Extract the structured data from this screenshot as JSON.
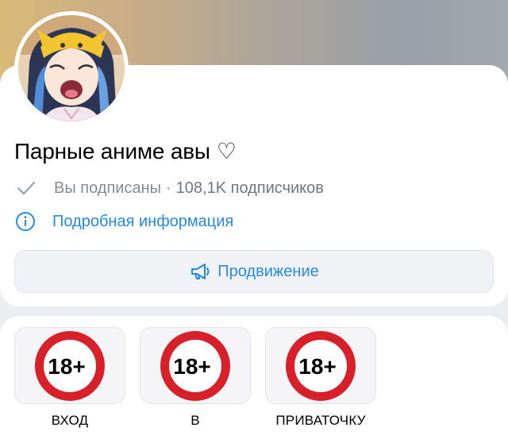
{
  "group": {
    "name": "Парные аниме авы",
    "heart": "♡",
    "subscription_status": "Вы подписаны",
    "separator": "·",
    "subscribers": "108,1K подписчиков",
    "details_link": "Подробная информация",
    "promo_button": "Продвижение"
  },
  "tiles": [
    {
      "badge": "18+",
      "label": "ВХОД"
    },
    {
      "badge": "18+",
      "label": "В"
    },
    {
      "badge": "18+",
      "label": "ПРИВАТОЧКУ"
    }
  ],
  "colors": {
    "accent": "#2688eb",
    "secondary_text": "#818c99",
    "badge_red": "#d8202a"
  },
  "icons": {
    "subscribed": "checkmark-icon",
    "info": "info-circle-icon",
    "promo": "megaphone-icon"
  }
}
